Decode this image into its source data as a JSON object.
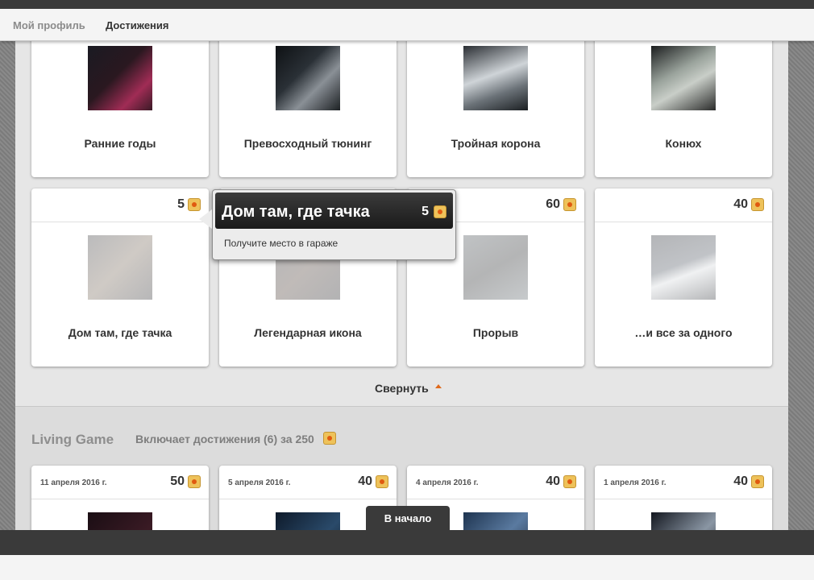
{
  "nav": {
    "profile": "Мой профиль",
    "achievements": "Достижения"
  },
  "row1": [
    {
      "title": "Ранние годы"
    },
    {
      "title": "Превосходный тюнинг"
    },
    {
      "title": "Тройная корона"
    },
    {
      "title": "Конюх"
    }
  ],
  "row2": [
    {
      "title": "Дом там, где тачка",
      "points": "5"
    },
    {
      "title": "Легендарная икона",
      "points": ""
    },
    {
      "title": "Прорыв",
      "points": "60"
    },
    {
      "title": "…и все за одного",
      "points": "40"
    }
  ],
  "tooltip": {
    "title": "Дом там, где тачка",
    "points": "5",
    "description": "Получите место в гараже"
  },
  "collapse_label": "Свернуть",
  "game": {
    "name": "Living Game",
    "summary": "Включает достижения (6) за 250"
  },
  "row3": [
    {
      "date": "11 апреля 2016 г.",
      "points": "50"
    },
    {
      "date": "5 апреля 2016 г.",
      "points": "40"
    },
    {
      "date": "4 апреля 2016 г.",
      "points": "40"
    },
    {
      "date": "1 апреля 2016 г.",
      "points": "40"
    }
  ],
  "back_to_top": "В начало",
  "icons": {
    "points": "points-coin-icon",
    "collapse": "caret-up-icon"
  },
  "colors": {
    "accent": "#e06a1c",
    "coin": "#eec25a"
  }
}
